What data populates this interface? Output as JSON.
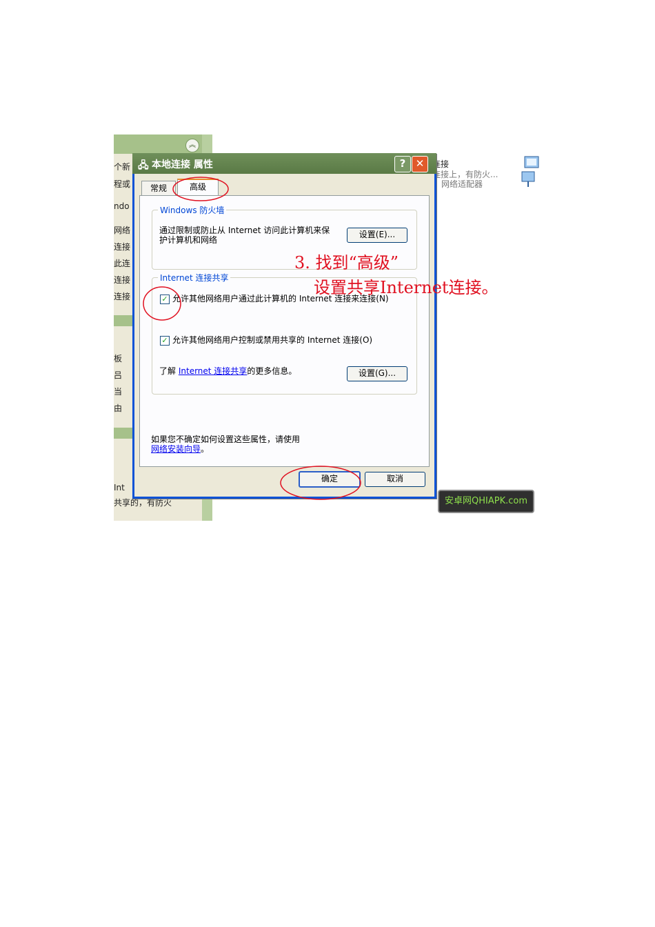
{
  "left_pane": {
    "texts": [
      "个新",
      "程或",
      "ndo",
      "网络",
      "连接",
      "此连",
      "连接",
      "连接",
      "板",
      "吕",
      "当",
      "由",
      "Int",
      "共享的，有防火"
    ]
  },
  "right_list": {
    "line1": "连接",
    "line2": "连接上，有防火...",
    "line3": "网络适配器"
  },
  "dialog": {
    "title": "本地连接 属性",
    "help_label": "?",
    "close_label": "✕",
    "tabs": [
      "常规",
      "高级"
    ],
    "firewall_group": {
      "title": "Windows 防火墙",
      "text": "通过限制或防止从 Internet 访问此计算机来保护计算机和网络",
      "settings_button": "设置(E)..."
    },
    "ics_group": {
      "title": "Internet 连接共享",
      "checkbox1_label": "允许其他网络用户通过此计算机的 Internet 连接来连接(N)",
      "checkbox1_checked": true,
      "checkbox2_label": "允许其他网络用户控制或禁用共享的 Internet 连接(O)",
      "checkbox2_checked": true,
      "learn_prefix": "了解",
      "learn_link": "Internet 连接共享",
      "learn_suffix": "的更多信息。",
      "settings_button": "设置(G)..."
    },
    "footer_text": "如果您不确定如何设置这些属性，请使用",
    "footer_link": "网络安装向导",
    "footer_end": "。",
    "ok_button": "确定",
    "cancel_button": "取消"
  },
  "annotation": {
    "line1": "3. 找到“高级”",
    "line2": "设置共享Internet连接。"
  },
  "watermark": "安卓网QHIAPK.com",
  "colors": {
    "annotation_red": "#e01020",
    "title_green": "#5a7a45",
    "close_red": "#e05a2b"
  }
}
